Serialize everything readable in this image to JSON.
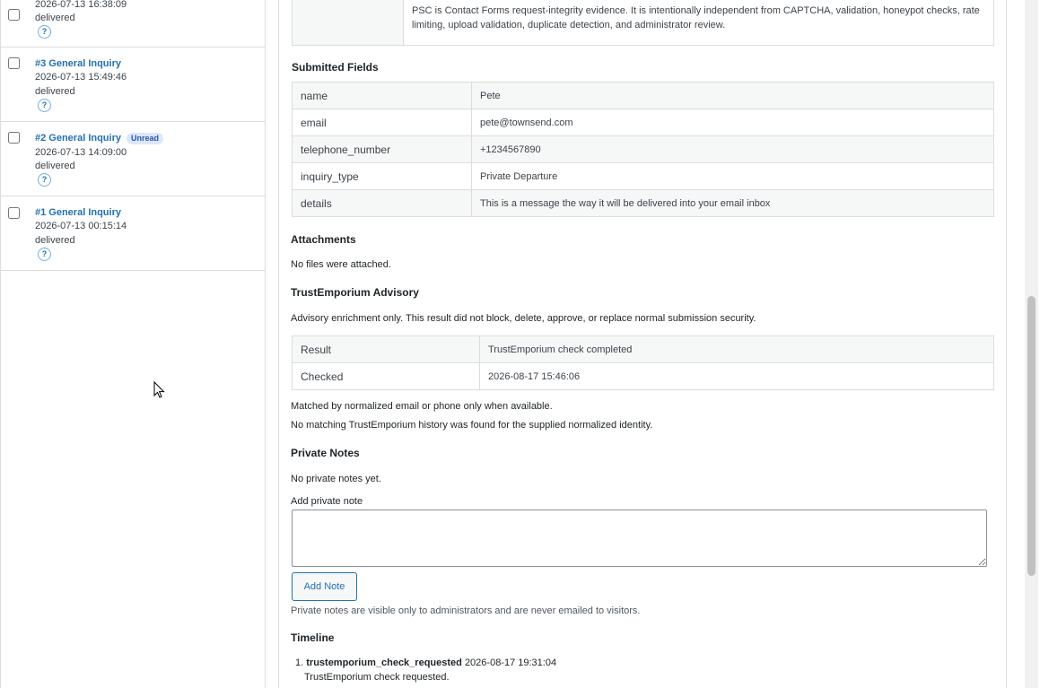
{
  "list": {
    "items": [
      {
        "title": "",
        "date": "2026-07-13 16:38:09",
        "status": "delivered",
        "help": "?",
        "badge": ""
      },
      {
        "title": "#3 General Inquiry",
        "date": "2026-07-13 15:49:46",
        "status": "delivered",
        "help": "?",
        "badge": ""
      },
      {
        "title": "#2 General Inquiry",
        "date": "2026-07-13 14:09:00",
        "status": "delivered",
        "help": "?",
        "badge": "Unread"
      },
      {
        "title": "#1 General Inquiry",
        "date": "2026-07-13 00:15:14",
        "status": "delivered",
        "help": "?",
        "badge": ""
      }
    ]
  },
  "psc_text": "PSC is Contact Forms request-integrity evidence. It is intentionally independent from CAPTCHA, validation, honeypot checks, rate limiting, upload validation, duplicate detection, and administrator review.",
  "submitted": {
    "heading": "Submitted Fields",
    "rows": [
      {
        "key": "name",
        "value": "Pete"
      },
      {
        "key": "email",
        "value": "pete@townsend.com"
      },
      {
        "key": "telephone_number",
        "value": "+1234567890"
      },
      {
        "key": "inquiry_type",
        "value": "Private Departure"
      },
      {
        "key": "details",
        "value": "This is a message the way it will be delivered into your email inbox"
      }
    ]
  },
  "attachments": {
    "heading": "Attachments",
    "text": "No files were attached."
  },
  "advisory": {
    "heading": "TrustEmporium Advisory",
    "intro": "Advisory enrichment only. This result did not block, delete, approve, or replace normal submission security.",
    "rows": [
      {
        "key": "Result",
        "value": "TrustEmporium check completed"
      },
      {
        "key": "Checked",
        "value": "2026-08-17 15:46:06"
      }
    ],
    "note1": "Matched by normalized email or phone only when available.",
    "note2": "No matching TrustEmporium history was found for the supplied normalized identity."
  },
  "notes": {
    "heading": "Private Notes",
    "empty": "No private notes yet.",
    "label": "Add private note",
    "button": "Add Note",
    "footer": "Private notes are visible only to administrators and are never emailed to visitors."
  },
  "timeline": {
    "heading": "Timeline",
    "entries": [
      {
        "num": "1.",
        "event": "trustemporium_check_requested",
        "time": "2026-08-17 19:31:04",
        "desc": "TrustEmporium check requested."
      }
    ]
  },
  "colors": {
    "link": "#2271b1",
    "badge_bg": "#dbe7fb"
  }
}
